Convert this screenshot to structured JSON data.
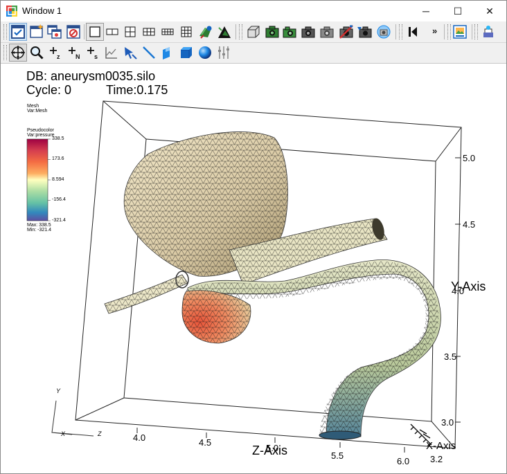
{
  "window": {
    "title": "Window 1",
    "minimize": "─",
    "maximize": "☐",
    "close": "✕"
  },
  "toolbar1": {
    "overflow": "»",
    "buttons": [
      "visit-active-window-icon",
      "new-window-icon",
      "clone-window-icon",
      "delete-window-icon",
      "layout-1x1-icon",
      "layout-1x2-icon",
      "layout-2x2-icon",
      "layout-2x3-icon",
      "layout-2x4-icon",
      "layout-3x3-icon",
      "lock-view-icon",
      "lock-time-icon",
      "reset-view-icon",
      "camera-icon",
      "camera-2-icon",
      "camera-3-icon",
      "camera-4-icon",
      "camera-5-icon",
      "camera-6-icon",
      "camera-7-icon",
      "animation-play-icon",
      "save-image-icon",
      "print-icon"
    ]
  },
  "toolbar2": {
    "buttons": [
      "navigate-mode-icon",
      "zoom-mode-icon",
      "zone-pick-icon",
      "node-pick-icon",
      "spreadsheet-pick-icon",
      "lineout-icon",
      "pointer-tool-icon",
      "line-tool-icon",
      "plane-tool-icon",
      "box-tool-icon",
      "sphere-tool-icon",
      "sliders-icon"
    ]
  },
  "annotation": {
    "db": "DB: aneurysm0035.silo",
    "cycle": "Cycle: 0",
    "time": "Time:0.175",
    "mesh_plot": "Mesh",
    "mesh_var": "Var:Mesh"
  },
  "legend": {
    "plot": "Pseudocolor",
    "var": "Var:pressure",
    "ticks": [
      "338.5",
      "173.6",
      "8.594",
      "-156.4",
      "-321.4"
    ],
    "max": "Max: 338.5",
    "min": "Min: -321.4",
    "colors": [
      "#9e0142",
      "#f46d43",
      "#fdae61",
      "#ffffbf",
      "#abdda4",
      "#66c2a5",
      "#3288bd",
      "#5e4fa2"
    ]
  },
  "axes": {
    "y_ticks": [
      "5.0",
      "4.5",
      "4.0",
      "3.5",
      "3.0"
    ],
    "z_ticks": [
      "4.0",
      "4.5",
      "5.0",
      "5.5",
      "6.0"
    ],
    "x_tick": "3.2",
    "y_label": "Y-Axis",
    "z_label": "Z-Axis",
    "x_label": "X-Axis",
    "triad_y": "Y",
    "triad_x": "X",
    "triad_z": "Z"
  }
}
